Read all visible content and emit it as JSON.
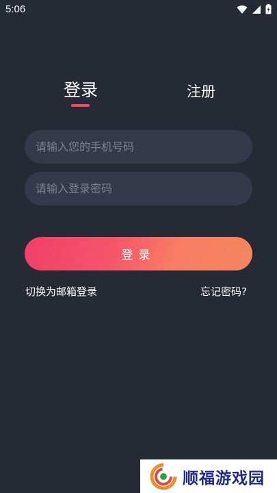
{
  "status_bar": {
    "time": "5:06",
    "icons": [
      "wifi-icon",
      "signal-icon",
      "battery-icon"
    ]
  },
  "tabs": {
    "login": "登录",
    "register": "注册",
    "active": "login",
    "indicator_color": "#f2476a"
  },
  "form": {
    "phone_placeholder": "请输入您的手机号码",
    "phone_value": "",
    "password_placeholder": "请输入登录密码",
    "password_value": ""
  },
  "login_button": {
    "label": "登录",
    "gradient_start": "#f03f68",
    "gradient_end": "#f6865f"
  },
  "links": {
    "switch_email": "切换为邮箱登录",
    "forgot_password": "忘记密码?"
  },
  "watermark": {
    "text": "顺福游戏园",
    "text_color": "#1f2a8a"
  },
  "colors": {
    "background": "#262a35",
    "input_background": "#343a4c",
    "placeholder": "#7b8090"
  }
}
